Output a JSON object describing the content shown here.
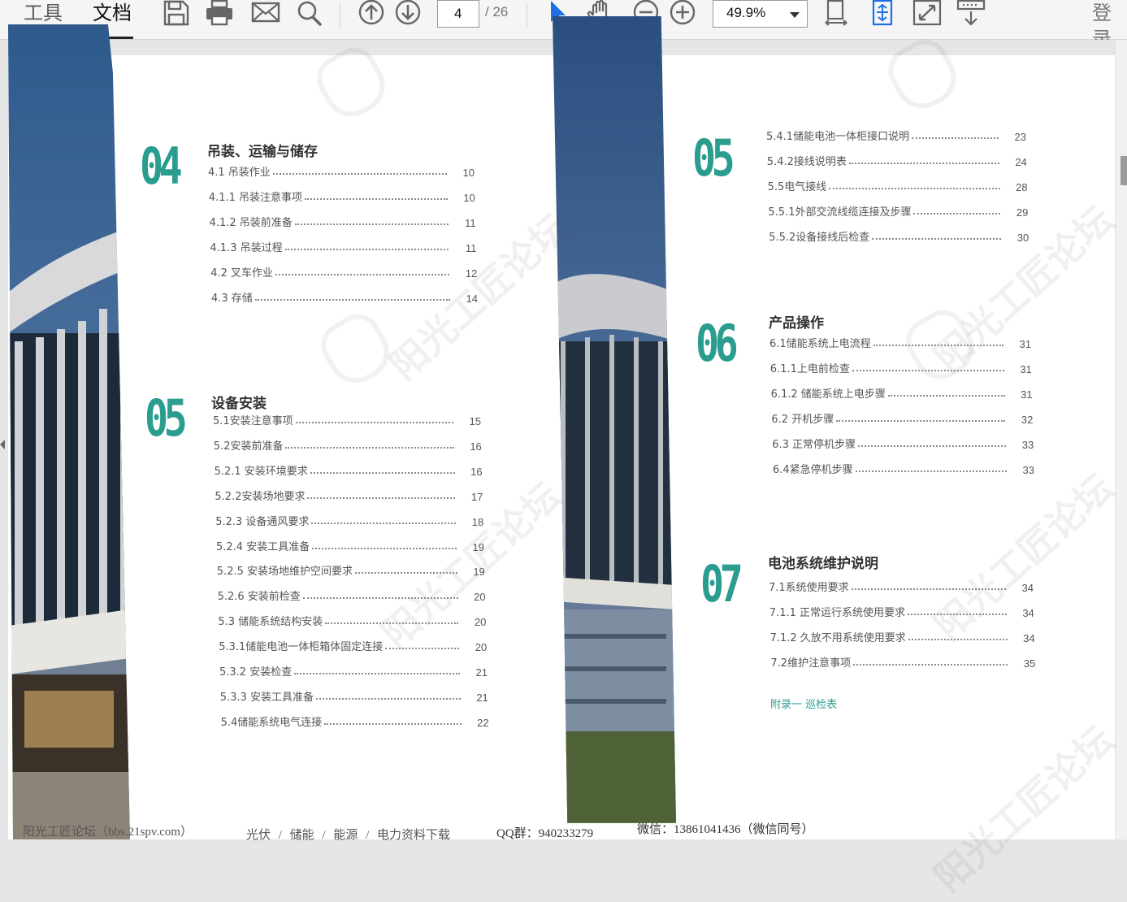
{
  "toolbar": {
    "tab_tools": "工具",
    "tab_document": "文档",
    "page_current": "4",
    "page_total": "/ 26",
    "zoom_value": "49.9%",
    "login": "登录",
    "icons": [
      "save-icon",
      "print-icon",
      "email-icon",
      "search-icon",
      "arrow-up-circle-icon",
      "arrow-down-circle-icon",
      "select-cursor-icon",
      "hand-pan-icon",
      "zoom-out-icon",
      "zoom-in-icon",
      "fit-page-icon",
      "fit-width-icon",
      "fullscreen-icon",
      "read-mode-icon"
    ],
    "accent_color": "#1f6fe5"
  },
  "toc": {
    "accent_color": "#2a9d8f",
    "sections": [
      {
        "number": "04",
        "title": "吊装、运输与储存",
        "items": [
          {
            "text": "4.1 吊装作业",
            "page": "10"
          },
          {
            "text": "4.1.1 吊装注意事项",
            "page": "10"
          },
          {
            "text": "4.1.2 吊装前准备",
            "page": "11"
          },
          {
            "text": "4.1.3 吊装过程",
            "page": "11"
          },
          {
            "text": "4.2 叉车作业",
            "page": "12"
          },
          {
            "text": "4.3 存储",
            "page": "14"
          }
        ]
      },
      {
        "number": "05",
        "title": "设备安装",
        "items": [
          {
            "text": "5.1安装注意事项",
            "page": "15"
          },
          {
            "text": "5.2安装前准备",
            "page": "16"
          },
          {
            "text": "5.2.1 安装环境要求",
            "page": "16"
          },
          {
            "text": "5.2.2安装场地要求",
            "page": "17"
          },
          {
            "text": "5.2.3 设备通风要求",
            "page": "18"
          },
          {
            "text": "5.2.4 安装工具准备",
            "page": "19"
          },
          {
            "text": "5.2.5 安装场地维护空间要求",
            "page": "19"
          },
          {
            "text": "5.2.6 安装前检查",
            "page": "20"
          },
          {
            "text": "5.3 储能系统结构安装",
            "page": "20"
          },
          {
            "text": "5.3.1储能电池一体柜箱体固定连接",
            "page": "20"
          },
          {
            "text": "5.3.2  安装检查",
            "page": "21"
          },
          {
            "text": "5.3.3 安装工具准备",
            "page": "21"
          },
          {
            "text": "5.4储能系统电气连接",
            "page": "22"
          }
        ]
      },
      {
        "number": "05",
        "title": "",
        "items": [
          {
            "text": "5.4.1储能电池一体柜接口说明",
            "page": "23"
          },
          {
            "text": "5.4.2接线说明表",
            "page": "24"
          },
          {
            "text": "5.5电气接线",
            "page": "28"
          },
          {
            "text": "5.5.1外部交流线缆连接及步骤",
            "page": "29"
          },
          {
            "text": "5.5.2设备接线后检查",
            "page": "30"
          }
        ]
      },
      {
        "number": "06",
        "title": "产品操作",
        "items": [
          {
            "text": "6.1储能系统上电流程",
            "page": "31"
          },
          {
            "text": "6.1.1上电前检查",
            "page": "31"
          },
          {
            "text": "6.1.2 储能系统上电步骤",
            "page": "31"
          },
          {
            "text": "6.2  开机步骤",
            "page": "32"
          },
          {
            "text": "6.3 正常停机步骤",
            "page": "33"
          },
          {
            "text": "6.4紧急停机步骤",
            "page": "33"
          }
        ]
      },
      {
        "number": "07",
        "title": "电池系统维护说明",
        "items": [
          {
            "text": "7.1系统使用要求",
            "page": "34"
          },
          {
            "text": "7.1.1 正常运行系统使用要求",
            "page": "34"
          },
          {
            "text": "7.1.2 久放不用系统使用要求",
            "page": "34"
          },
          {
            "text": "7.2维护注意事项",
            "page": "35"
          }
        ]
      }
    ],
    "appendix": "附录一 巡检表"
  },
  "watermark": {
    "text": "阳光工匠论坛",
    "url": "BBS.21SPV.COM"
  },
  "footer": {
    "left": "阳光工匠论坛（bbs.21spv.com）",
    "categories": "光伏 / 储能 / 能源 / 电力资料下载",
    "qq": "QQ群：940233279",
    "wechat": "微信：13861041436（微信同号）"
  }
}
